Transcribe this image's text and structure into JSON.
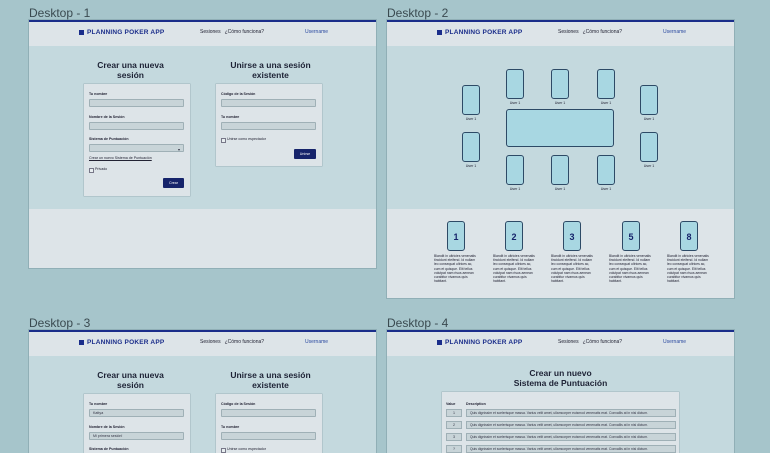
{
  "frames": {
    "d1": {
      "label": "Desktop - 1"
    },
    "d2": {
      "label": "Desktop - 2"
    },
    "d3": {
      "label": "Desktop - 3"
    },
    "d4": {
      "label": "Desktop - 4"
    }
  },
  "header": {
    "logo": "PLANNING POKER APP",
    "nav_sessions": "Sesiones",
    "nav_how": "¿Cómo funciona?",
    "username": "Username"
  },
  "create": {
    "title_line1": "Crear una nueva",
    "title_line2": "sesión",
    "name_label": "Tu nombre",
    "session_name_label": "Nombre de la Sesión",
    "scoring_label": "Sistema de Puntuación",
    "new_scoring_link": "Crear un nuevo Sistema de Puntuación",
    "private_label": "Privado",
    "create_button": "Crear"
  },
  "join": {
    "title_line1": "Unirse a una sesión",
    "title_line2": "existente",
    "code_label": "Código de la Sesión",
    "name_label": "Tu nombre",
    "spectator_label": "Unirse como espectador",
    "join_button": "Unirse"
  },
  "filled": {
    "name_value": "Kattya",
    "session_value": "Mi primera sesión!"
  },
  "room": {
    "seat_label": "User 1",
    "cards": [
      {
        "value": "1",
        "desc": "Blandit in ultricies venenatis tincidunt eleifend. Id nullam leo consequat ultrices ac, cum et quisque. Elit tellus volutpat nam risus aenean curabitur vivamus quis habitant."
      },
      {
        "value": "2",
        "desc": "Blandit in ultricies venenatis tincidunt eleifend. Id nullam leo consequat ultrices ac, cum et quisque. Elit tellus volutpat nam risus aenean curabitur vivamus quis habitant."
      },
      {
        "value": "3",
        "desc": "Blandit in ultricies venenatis tincidunt eleifend. Id nullam leo consequat ultrices ac, cum et quisque. Elit tellus volutpat nam risus aenean curabitur vivamus quis habitant."
      },
      {
        "value": "5",
        "desc": "Blandit in ultricies venenatis tincidunt eleifend. Id nullam leo consequat ultrices ac, cum et quisque. Elit tellus volutpat nam risus aenean curabitur vivamus quis habitant."
      },
      {
        "value": "8",
        "desc": "Blandit in ultricies venenatis tincidunt eleifend. Id nullam leo consequat ultrices ac, cum et quisque. Elit tellus volutpat nam risus aenean curabitur vivamus quis habitant."
      }
    ]
  },
  "scoring": {
    "title_line1": "Crear un nuevo",
    "title_line2": "Sistema de Puntuación",
    "col_value": "Value",
    "col_desc": "Description",
    "rows": [
      {
        "value": "1",
        "desc": "Quis dignissim et scelerisque massa. Varius velit amet, ullamcorper euismod venenatis erat. Convallis at in nisi dictum."
      },
      {
        "value": "2",
        "desc": "Quis dignissim et scelerisque massa. Varius velit amet, ullamcorper euismod venenatis erat. Convallis at in nisi dictum."
      },
      {
        "value": "3",
        "desc": "Quis dignissim et scelerisque massa. Varius velit amet, ullamcorper euismod venenatis erat. Convallis at in nisi dictum."
      },
      {
        "value": "?",
        "desc": "Quis dignissim et scelerisque massa. Varius velit amet, ullamcorper euismod venenatis erat. Convallis at in nisi dictum."
      }
    ]
  }
}
